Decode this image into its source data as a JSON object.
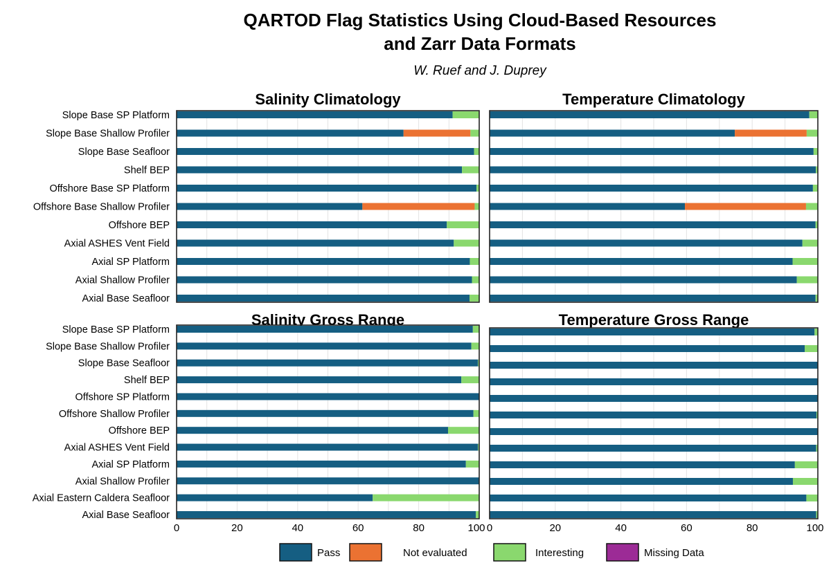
{
  "title_line1": "QARTOD Flag Statistics Using Cloud-Based Resources",
  "title_line2": "and Zarr Data Formats",
  "subtitle": "W. Ruef and J. Duprey",
  "colors": {
    "pass": "#155e82",
    "not_evaluated": "#eb7232",
    "interesting": "#8ad86e",
    "missing": "#9c2b96"
  },
  "legend": [
    "Pass",
    "Not evaluated",
    "Interesting",
    "Missing Data"
  ],
  "chart_data": [
    {
      "type": "bar",
      "orientation": "horizontal",
      "stacked": true,
      "title": "Salinity Climatology",
      "categories": [
        "Slope Base SP Platform",
        "Slope Base Shallow Profiler",
        "Slope Base Seafloor",
        "Shelf BEP",
        "Offshore Base SP Platform",
        "Offshore Base Shallow Profiler",
        "Offshore BEP",
        "Axial ASHES Vent Field",
        "Axial SP Platform",
        "Axial Shallow Profiler",
        "Axial Base Seafloor"
      ],
      "series": [
        {
          "name": "Pass",
          "values": [
            91.2,
            75.0,
            98.3,
            94.3,
            99.1,
            61.4,
            89.3,
            91.6,
            96.9,
            97.6,
            96.8
          ]
        },
        {
          "name": "Not evaluated",
          "values": [
            0,
            22.1,
            0,
            0,
            0,
            37.1,
            0,
            0,
            0,
            0,
            0
          ]
        },
        {
          "name": "Interesting",
          "values": [
            8.8,
            2.9,
            1.7,
            5.7,
            0.9,
            1.5,
            10.7,
            8.4,
            3.1,
            2.4,
            3.2
          ]
        },
        {
          "name": "Missing Data",
          "values": [
            0,
            0,
            0,
            0,
            0,
            0,
            0,
            0,
            0,
            0,
            0
          ]
        }
      ],
      "xlim": [
        0,
        100
      ],
      "grid": true
    },
    {
      "type": "bar",
      "orientation": "horizontal",
      "stacked": true,
      "title": "Temperature Climatology",
      "categories": [
        "Slope Base SP Platform",
        "Slope Base Shallow Profiler",
        "Slope Base Seafloor",
        "Shelf BEP",
        "Offshore Base SP Platform",
        "Offshore Base Shallow Profiler",
        "Offshore BEP",
        "Axial ASHES Vent Field",
        "Axial SP Platform",
        "Axial Shallow Profiler",
        "Axial Base Seafloor"
      ],
      "series": [
        {
          "name": "Pass",
          "values": [
            97.4,
            74.7,
            98.7,
            99.4,
            98.5,
            59.5,
            99.3,
            95.3,
            92.3,
            93.6,
            99.3
          ]
        },
        {
          "name": "Not evaluated",
          "values": [
            0,
            21.9,
            0,
            0,
            0,
            36.9,
            0,
            0,
            0,
            0,
            0
          ]
        },
        {
          "name": "Interesting",
          "values": [
            2.6,
            3.4,
            1.3,
            0.6,
            1.5,
            3.6,
            0.7,
            4.7,
            7.7,
            6.4,
            0.7
          ]
        },
        {
          "name": "Missing Data",
          "values": [
            0,
            0,
            0,
            0,
            0,
            0,
            0,
            0,
            0,
            0,
            0
          ]
        }
      ],
      "xlim": [
        0,
        100
      ],
      "grid": true
    },
    {
      "type": "bar",
      "orientation": "horizontal",
      "stacked": true,
      "title": "Salinity Gross Range",
      "categories": [
        "Slope Base SP Platform",
        "Slope Base Shallow Profiler",
        "Slope Base Seafloor",
        "Shelf BEP",
        "Offshore SP Platform",
        "Offshore Shallow Profiler",
        "Offshore BEP",
        "Axial ASHES Vent Field",
        "Axial SP Platform",
        "Axial Shallow Profiler",
        "Axial Eastern Caldera Seafloor",
        "Axial Base Seafloor"
      ],
      "series": [
        {
          "name": "Pass",
          "values": [
            97.9,
            97.4,
            99.6,
            94.1,
            100,
            98.1,
            89.7,
            99.6,
            95.6,
            100,
            64.8,
            98.9
          ]
        },
        {
          "name": "Not evaluated",
          "values": [
            0,
            0,
            0,
            0,
            0,
            0,
            0,
            0,
            0,
            0,
            0,
            0
          ]
        },
        {
          "name": "Interesting",
          "values": [
            2.1,
            2.6,
            0.4,
            5.9,
            0,
            1.9,
            10.3,
            0.4,
            4.4,
            0,
            35.2,
            1.1
          ]
        },
        {
          "name": "Missing Data",
          "values": [
            0,
            0,
            0,
            0,
            0,
            0,
            0,
            0,
            0,
            0,
            0,
            0
          ]
        }
      ],
      "xlim": [
        0,
        100
      ],
      "xticks": [
        0,
        20,
        40,
        60,
        80,
        100
      ],
      "grid": true
    },
    {
      "type": "bar",
      "orientation": "horizontal",
      "stacked": true,
      "title": "Temperature Gross Range",
      "categories": [
        "Slope Base SP Platform",
        "Slope Base Shallow Profiler",
        "Slope Base Seafloor",
        "Shelf BEP",
        "Offshore SP Platform",
        "Offshore Shallow Profiler",
        "Offshore BEP",
        "Axial ASHES Vent Field",
        "Axial SP Platform",
        "Axial Shallow Profiler",
        "Axial Eastern Caldera Seafloor",
        "Axial Base Seafloor"
      ],
      "series": [
        {
          "name": "Pass",
          "values": [
            99.0,
            96.0,
            100,
            100,
            100,
            99.6,
            100,
            99.5,
            93.0,
            92.4,
            96.5,
            99.5
          ]
        },
        {
          "name": "Not evaluated",
          "values": [
            0,
            0,
            0,
            0,
            0,
            0,
            0,
            0,
            0,
            0,
            0,
            0
          ]
        },
        {
          "name": "Interesting",
          "values": [
            1.0,
            4.0,
            0,
            0,
            0,
            0.4,
            0,
            0.5,
            7.0,
            7.6,
            3.5,
            0.5
          ]
        },
        {
          "name": "Missing Data",
          "values": [
            0,
            0,
            0,
            0,
            0,
            0,
            0,
            0,
            0,
            0,
            0,
            0
          ]
        }
      ],
      "xlim": [
        0,
        100
      ],
      "xticks": [
        0,
        20,
        40,
        60,
        80,
        100
      ],
      "grid": true
    }
  ]
}
